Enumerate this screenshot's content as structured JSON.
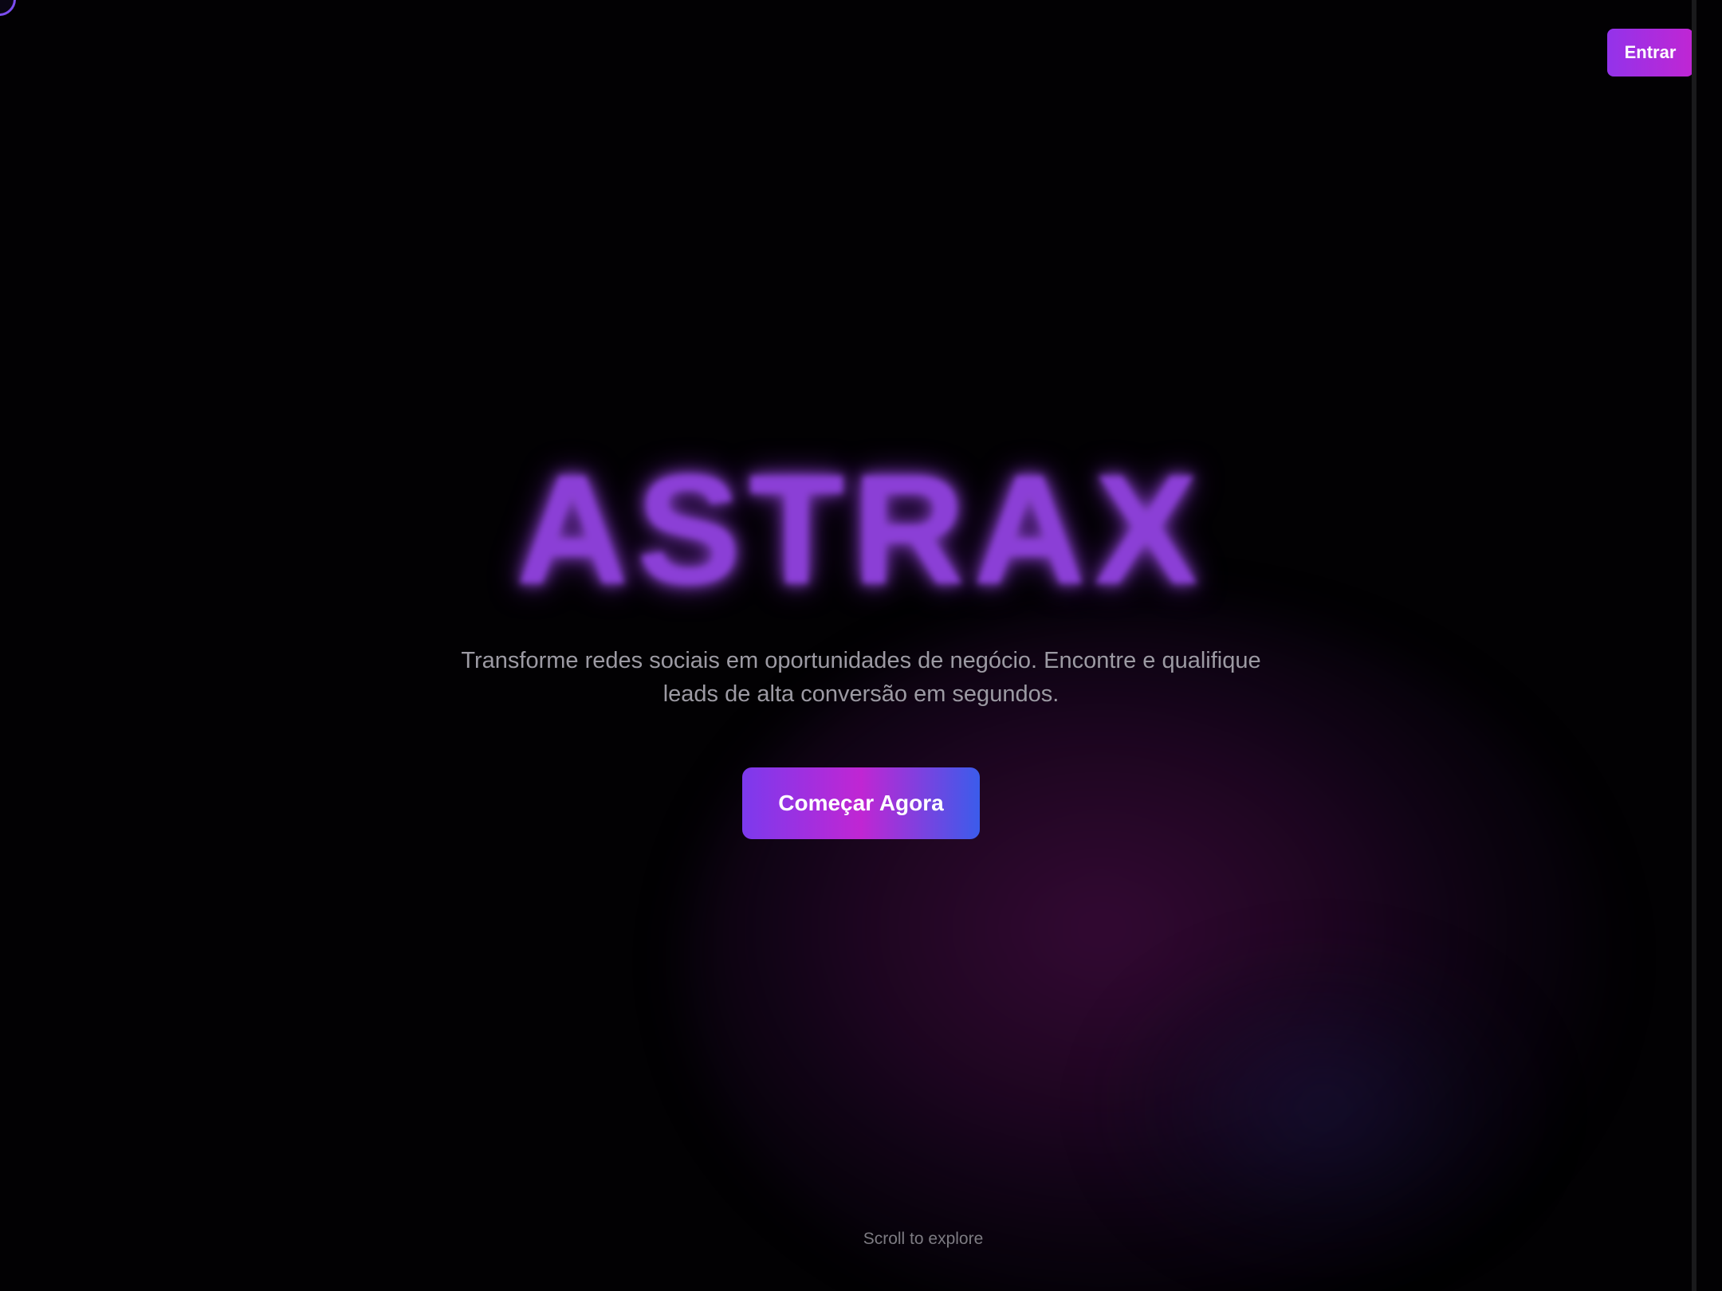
{
  "header": {
    "login_label": "Entrar"
  },
  "hero": {
    "title": "ASTRAX",
    "subtitle": "Transforme redes sociais em oportunidades de negócio. Encontre e qualifique leads de alta conversão em segundos.",
    "cta_label": "Começar Agora"
  },
  "footer": {
    "scroll_hint": "Scroll to explore"
  },
  "colors": {
    "background": "#020103",
    "accent_purple": "#9333ea",
    "accent_magenta": "#c026d3",
    "accent_blue": "#3b5ceb",
    "title_glow": "#8b3fd6",
    "subtitle_text": "#9c9aa3"
  },
  "icons": {
    "corner": "loading-circle-icon"
  }
}
